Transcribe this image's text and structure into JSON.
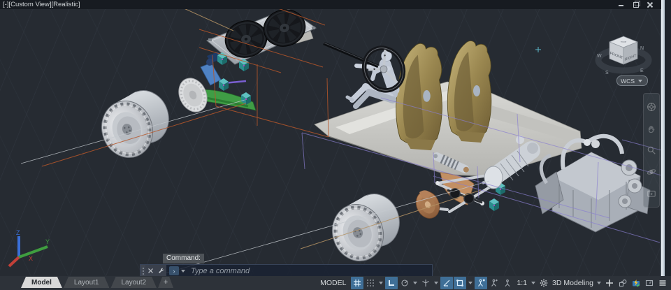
{
  "viewport_label": "[-][Custom View][Realistic]",
  "viewcube": {
    "front_label": "FRONT",
    "right_label": "RIGHT",
    "top_label": "TOP",
    "compass": {
      "north": "N",
      "south": "S",
      "east": "E",
      "west": "W"
    },
    "wcs_label": "WCS"
  },
  "ucs_axes": {
    "x": "X",
    "y": "Y",
    "z": "Z"
  },
  "command": {
    "history_label": "Command:",
    "input_placeholder": "Type a command"
  },
  "layout_tabs": {
    "tabs": [
      {
        "label": "Model",
        "active": true
      },
      {
        "label": "Layout1",
        "active": false
      },
      {
        "label": "Layout2",
        "active": false
      }
    ],
    "add_label": "+"
  },
  "statusbar": {
    "model_label": "MODEL",
    "annotation_scale": "1:1",
    "workspace_label": "3D Modeling",
    "toggles": [
      {
        "name": "grid-display",
        "active": true
      },
      {
        "name": "snap-mode",
        "active": false
      },
      {
        "name": "ortho-mode",
        "active": true
      },
      {
        "name": "polar-tracking",
        "active": false
      },
      {
        "name": "isometric-drafting",
        "active": false
      },
      {
        "name": "object-snap-tracking",
        "active": true
      },
      {
        "name": "object-snap",
        "active": true
      },
      {
        "name": "annotation-visibility",
        "active": true
      },
      {
        "name": "annotation-autoscale",
        "active": false
      },
      {
        "name": "annotation-monitor",
        "active": false
      }
    ]
  },
  "navigation_bar": {
    "icons": [
      "full-navigation-wheel",
      "pan",
      "zoom",
      "orbit",
      "show-motion"
    ]
  },
  "colors": {
    "background": "#262b32",
    "active_toggle": "#3f6f97",
    "orange_wireframe": "#b5562a",
    "purple_wireframe": "#8a7fd0",
    "teal_part": "#2b8d8d",
    "green_part": "#3f9d45",
    "blue_part": "#4f82c4",
    "gold_seat": "#9a8750",
    "scrollbar": "#c4d2dc"
  }
}
